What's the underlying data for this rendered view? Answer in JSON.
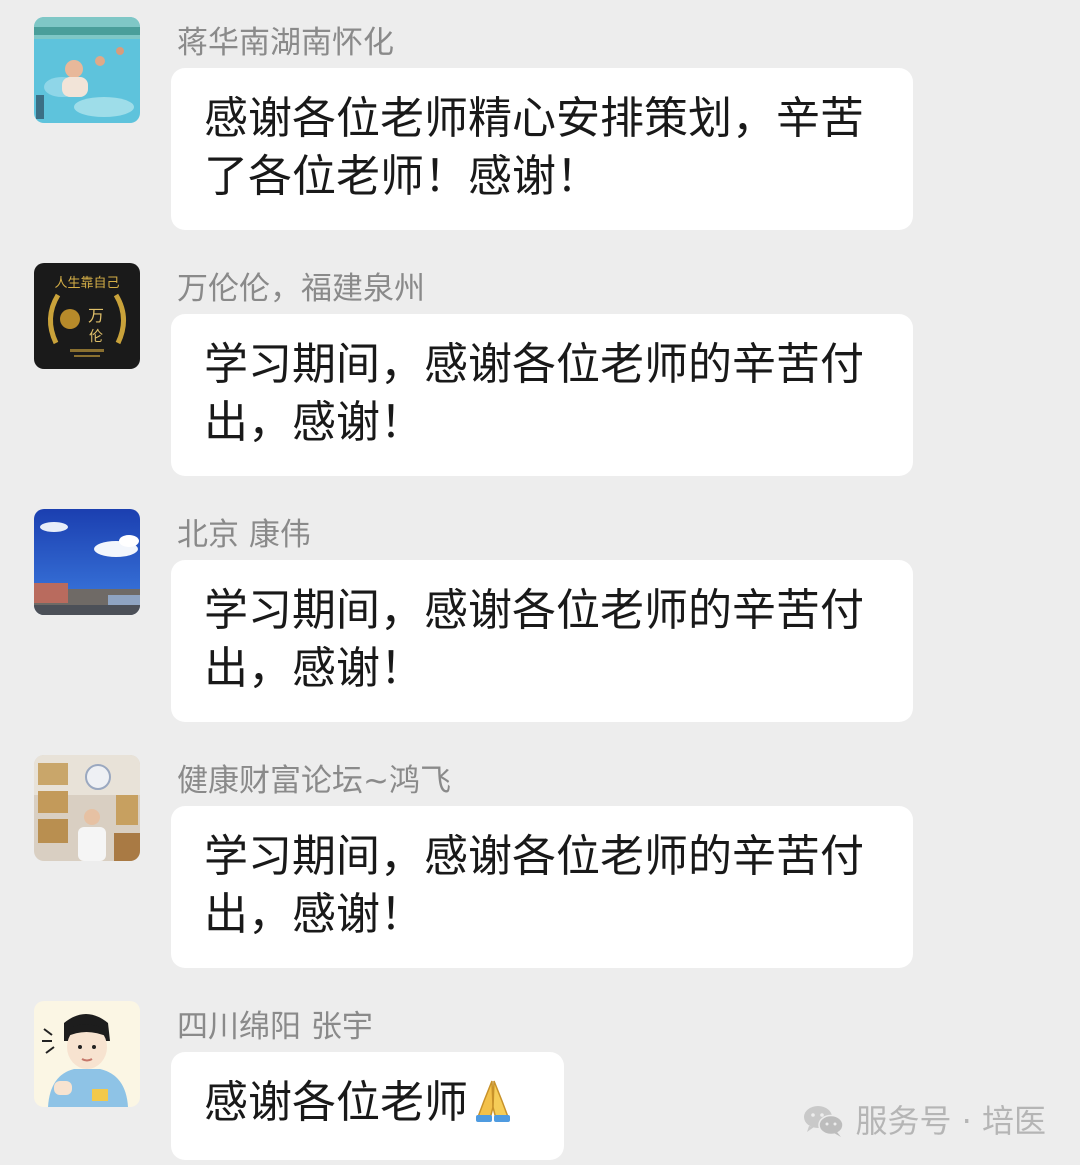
{
  "messages": [
    {
      "sender": "蒋华南湖南怀化",
      "avatar": "avatar-pool-photo",
      "text": "感谢各位老师精心安排策划，辛苦了各位老师！感谢！"
    },
    {
      "sender": "万伦伦，福建泉州",
      "avatar": "avatar-gold-emblem",
      "text": "学习期间，感谢各位老师的辛苦付出，感谢！"
    },
    {
      "sender": "北京 康伟",
      "avatar": "avatar-blue-sky",
      "text": "学习期间，感谢各位老师的辛苦付出，感谢！"
    },
    {
      "sender": "健康财富论坛~鸿飞",
      "avatar": "avatar-office-photo",
      "text": "学习期间，感谢各位老师的辛苦付出，感谢！"
    },
    {
      "sender": "四川绵阳 张宇",
      "avatar": "avatar-cartoon-boy",
      "text": "感谢各位老师",
      "emoji": "folded-hands"
    }
  ],
  "watermark": {
    "text": "服务号 · 培医",
    "icon": "wechat-icon"
  }
}
